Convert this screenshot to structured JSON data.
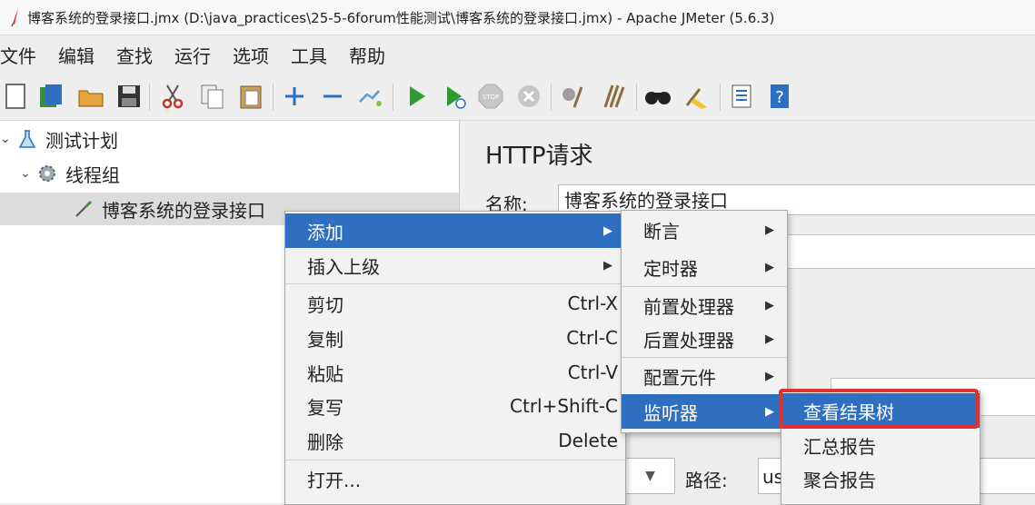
{
  "window": {
    "title": "博客系统的登录接口.jmx (D:\\java_practices\\25-5-6forum性能测试\\博客系统的登录接口.jmx) - Apache JMeter (5.6.3)"
  },
  "menubar": {
    "items": [
      "文件",
      "编辑",
      "查找",
      "运行",
      "选项",
      "工具",
      "帮助"
    ]
  },
  "toolbar": {
    "icons": [
      "new-icon",
      "templates-icon",
      "open-icon",
      "save-icon",
      "cut-icon",
      "copy-icon",
      "paste-icon",
      "expand-icon",
      "collapse-icon",
      "toggle-icon",
      "start-icon",
      "start-no-pause-icon",
      "stop-icon",
      "shutdown-icon",
      "clear-icon",
      "clear-all-icon",
      "search-icon",
      "reset-search-icon",
      "function-helper-icon",
      "help-icon"
    ]
  },
  "tree": {
    "test_plan": "测试计划",
    "thread_group": "线程组",
    "sampler": "博客系统的登录接口"
  },
  "panel": {
    "title": "HTTP请求",
    "name_label": "名称:",
    "name_value": "博客系统的登录接口",
    "path_label": "路径:",
    "path_value": "us"
  },
  "context_menu": {
    "add": "添加",
    "insert_parent": "插入上级",
    "cut": "剪切",
    "cut_shortcut": "Ctrl-X",
    "copy": "复制",
    "copy_shortcut": "Ctrl-C",
    "paste": "粘贴",
    "paste_shortcut": "Ctrl-V",
    "duplicate": "复写",
    "duplicate_shortcut": "Ctrl+Shift-C",
    "delete": "删除",
    "delete_shortcut": "Delete",
    "open": "打开..."
  },
  "add_submenu": {
    "assertions": "断言",
    "timer": "定时器",
    "pre_processors": "前置处理器",
    "post_processors": "后置处理器",
    "config_element": "配置元件",
    "listener": "监听器"
  },
  "listener_submenu": {
    "view_results_tree": "查看结果树",
    "summary_report": "汇总报告",
    "aggregate_report": "聚合报告"
  },
  "colors": {
    "menu_highlight": "#2f6fc1",
    "annotation_red": "#e03131"
  }
}
